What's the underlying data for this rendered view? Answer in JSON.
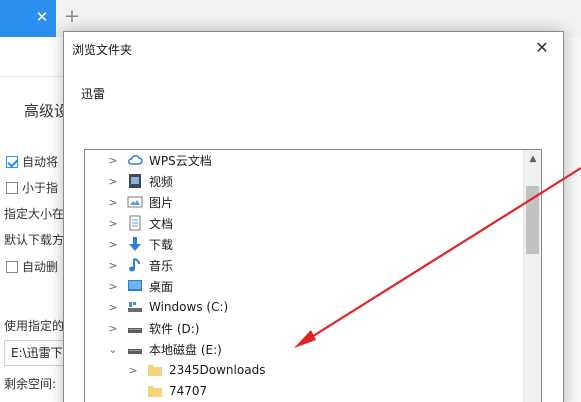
{
  "background_app": {
    "tab_close": "✕",
    "tab_new": "+",
    "section_title": "高级设",
    "rows": [
      {
        "label": "自动将",
        "checked": true
      },
      {
        "label": "小于指",
        "checked": false
      }
    ],
    "text1": "指定大小在",
    "text2": "默认下载方",
    "row3": {
      "label": "自动删",
      "checked": false
    },
    "text3": "使用指定的",
    "path_value": "E:\\迅雷下",
    "text4": "剩余空间:"
  },
  "dialog": {
    "title": "浏览文件夹",
    "close": "✕",
    "description": "迅雷",
    "tree": [
      {
        "label": "WPS云文档",
        "icon": "cloud-icon",
        "chevron": "right"
      },
      {
        "label": "视频",
        "icon": "video-folder-icon",
        "chevron": "right"
      },
      {
        "label": "图片",
        "icon": "pictures-folder-icon",
        "chevron": "right"
      },
      {
        "label": "文档",
        "icon": "documents-folder-icon",
        "chevron": "right"
      },
      {
        "label": "下载",
        "icon": "download-folder-icon",
        "chevron": "right"
      },
      {
        "label": "音乐",
        "icon": "music-folder-icon",
        "chevron": "right"
      },
      {
        "label": "桌面",
        "icon": "desktop-folder-icon",
        "chevron": "right"
      },
      {
        "label": "Windows (C:)",
        "icon": "system-drive-icon",
        "chevron": "right"
      },
      {
        "label": "软件 (D:)",
        "icon": "drive-icon",
        "chevron": "right"
      },
      {
        "label": "本地磁盘 (E:)",
        "icon": "drive-icon",
        "chevron": "down"
      },
      {
        "label": "2345Downloads",
        "icon": "folder-icon",
        "chevron": "right"
      },
      {
        "label": "74707",
        "icon": "folder-icon",
        "chevron": "none"
      }
    ]
  },
  "colors": {
    "accent": "#2b8ff0",
    "annotation_arrow": "#e02424",
    "folder": "#f5d37a"
  }
}
